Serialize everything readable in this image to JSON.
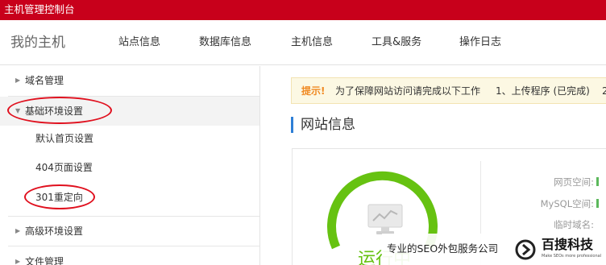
{
  "topbar": {
    "title": "主机管理控制台"
  },
  "navbar": {
    "brand": "我的主机",
    "items": [
      {
        "label": "站点信息"
      },
      {
        "label": "数据库信息"
      },
      {
        "label": "主机信息"
      },
      {
        "label": "工具&服务"
      },
      {
        "label": "操作日志"
      }
    ]
  },
  "sidebar": {
    "items": [
      {
        "label": "域名管理",
        "expanded": false
      },
      {
        "label": "基础环境设置",
        "expanded": true
      },
      {
        "label": "默认首页设置"
      },
      {
        "label": "404页面设置"
      },
      {
        "label": "301重定向"
      },
      {
        "label": "高级环境设置",
        "expanded": false
      },
      {
        "label": "文件管理",
        "expanded": false
      }
    ]
  },
  "notice": {
    "tag": "提示!",
    "text": "为了保障网站访问请完成以下工作",
    "step1": "1、上传程序 (已完成)",
    "step2": "2"
  },
  "section": {
    "title": "网站信息"
  },
  "info": {
    "web_space_label": "网页空间:",
    "mysql_space_label": "MySQL空间:",
    "temp_domain_label": "临时域名:"
  },
  "status": {
    "label": "运行中"
  },
  "watermark": {
    "text": "专业的SEO外包服务公司",
    "brand": "百搜科技",
    "subtitle": "Make SEOs more professional"
  },
  "colors": {
    "topbar": "#c8001b",
    "ring": "#66c211",
    "highlight_oval": "#e0101e",
    "section_accent": "#2e7fd6"
  }
}
